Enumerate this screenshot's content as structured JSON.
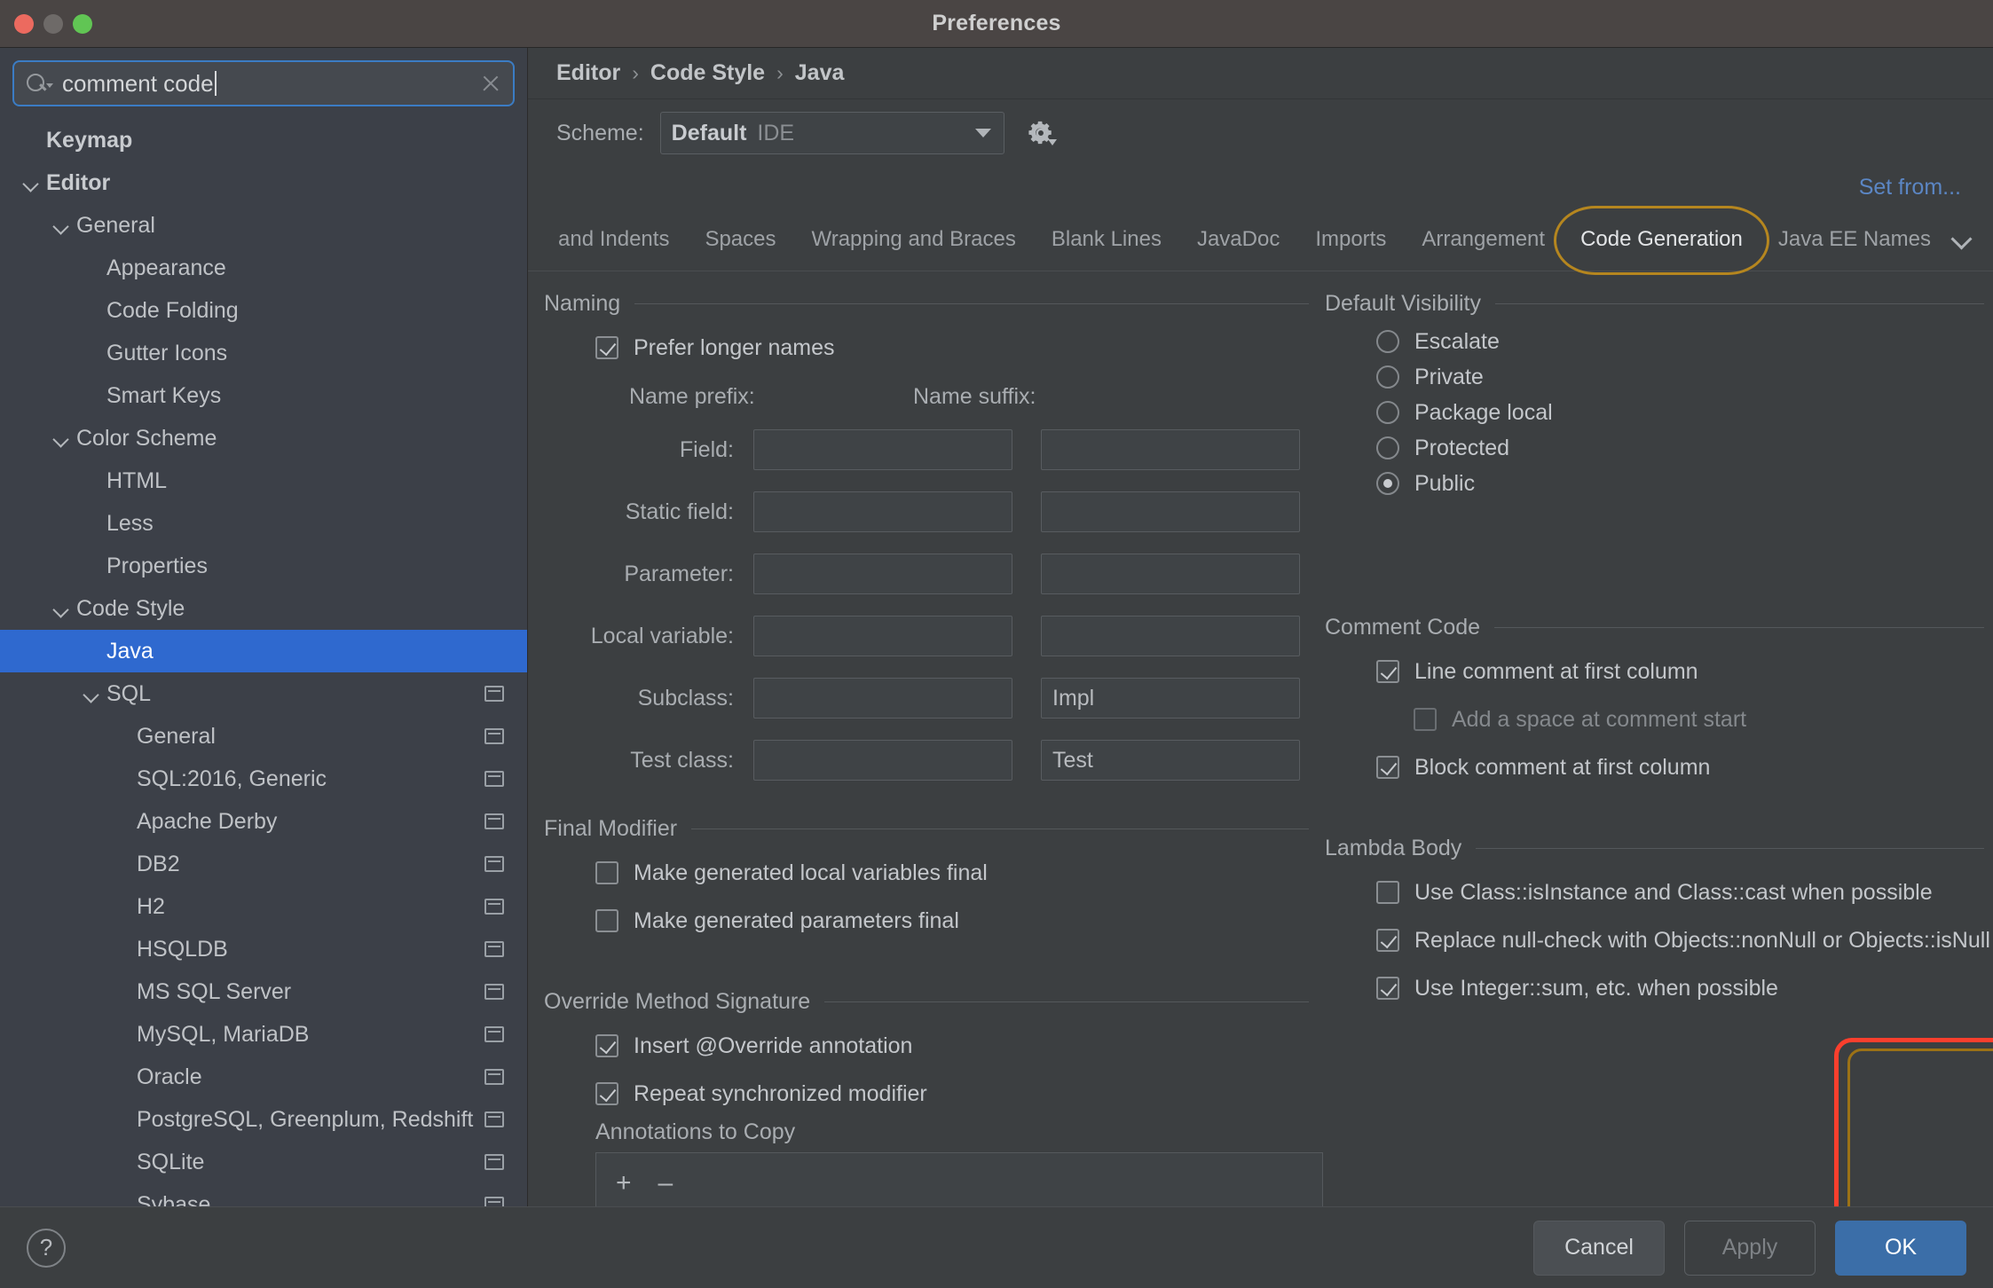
{
  "window": {
    "title": "Preferences"
  },
  "search": {
    "value": "comment code",
    "icon": "search-icon",
    "clear_icon": "clear-icon"
  },
  "sidebar": {
    "items": [
      {
        "label": "Keymap",
        "depth": 0,
        "bold": true,
        "chevron": false,
        "selected": false,
        "badge": false
      },
      {
        "label": "Editor",
        "depth": 0,
        "bold": true,
        "chevron": true,
        "selected": false,
        "badge": false
      },
      {
        "label": "General",
        "depth": 1,
        "bold": false,
        "chevron": true,
        "selected": false,
        "badge": false
      },
      {
        "label": "Appearance",
        "depth": 2,
        "bold": false,
        "chevron": false,
        "selected": false,
        "badge": false
      },
      {
        "label": "Code Folding",
        "depth": 2,
        "bold": false,
        "chevron": false,
        "selected": false,
        "badge": false
      },
      {
        "label": "Gutter Icons",
        "depth": 2,
        "bold": false,
        "chevron": false,
        "selected": false,
        "badge": false
      },
      {
        "label": "Smart Keys",
        "depth": 2,
        "bold": false,
        "chevron": false,
        "selected": false,
        "badge": false
      },
      {
        "label": "Color Scheme",
        "depth": 1,
        "bold": false,
        "chevron": true,
        "selected": false,
        "badge": false
      },
      {
        "label": "HTML",
        "depth": 2,
        "bold": false,
        "chevron": false,
        "selected": false,
        "badge": false
      },
      {
        "label": "Less",
        "depth": 2,
        "bold": false,
        "chevron": false,
        "selected": false,
        "badge": false
      },
      {
        "label": "Properties",
        "depth": 2,
        "bold": false,
        "chevron": false,
        "selected": false,
        "badge": false
      },
      {
        "label": "Code Style",
        "depth": 1,
        "bold": false,
        "chevron": true,
        "selected": false,
        "badge": false
      },
      {
        "label": "Java",
        "depth": 2,
        "bold": false,
        "chevron": false,
        "selected": true,
        "badge": false
      },
      {
        "label": "SQL",
        "depth": 2,
        "bold": false,
        "chevron": true,
        "selected": false,
        "badge": true
      },
      {
        "label": "General",
        "depth": 3,
        "bold": false,
        "chevron": false,
        "selected": false,
        "badge": true
      },
      {
        "label": "SQL:2016, Generic",
        "depth": 3,
        "bold": false,
        "chevron": false,
        "selected": false,
        "badge": true
      },
      {
        "label": "Apache Derby",
        "depth": 3,
        "bold": false,
        "chevron": false,
        "selected": false,
        "badge": true
      },
      {
        "label": "DB2",
        "depth": 3,
        "bold": false,
        "chevron": false,
        "selected": false,
        "badge": true
      },
      {
        "label": "H2",
        "depth": 3,
        "bold": false,
        "chevron": false,
        "selected": false,
        "badge": true
      },
      {
        "label": "HSQLDB",
        "depth": 3,
        "bold": false,
        "chevron": false,
        "selected": false,
        "badge": true
      },
      {
        "label": "MS SQL Server",
        "depth": 3,
        "bold": false,
        "chevron": false,
        "selected": false,
        "badge": true
      },
      {
        "label": "MySQL, MariaDB",
        "depth": 3,
        "bold": false,
        "chevron": false,
        "selected": false,
        "badge": true
      },
      {
        "label": "Oracle",
        "depth": 3,
        "bold": false,
        "chevron": false,
        "selected": false,
        "badge": true
      },
      {
        "label": "PostgreSQL, Greenplum, Redshift",
        "depth": 3,
        "bold": false,
        "chevron": false,
        "selected": false,
        "badge": true
      },
      {
        "label": "SQLite",
        "depth": 3,
        "bold": false,
        "chevron": false,
        "selected": false,
        "badge": true
      },
      {
        "label": "Sybase",
        "depth": 3,
        "bold": false,
        "chevron": false,
        "selected": false,
        "badge": true
      }
    ]
  },
  "breadcrumb": {
    "items": [
      "Editor",
      "Code Style",
      "Java"
    ],
    "separator": "›"
  },
  "scheme": {
    "label": "Scheme:",
    "value": "Default",
    "scope": "IDE",
    "gear_icon": "gear-icon",
    "arrow_icon": "chevron-down-icon"
  },
  "set_from": {
    "label": "Set from..."
  },
  "tabs": {
    "items": [
      "and Indents",
      "Spaces",
      "Wrapping and Braces",
      "Blank Lines",
      "JavaDoc",
      "Imports",
      "Arrangement",
      "Code Generation",
      "Java EE Names"
    ],
    "active": "Code Generation",
    "overflow_icon": "chevron-down-icon"
  },
  "naming": {
    "title": "Naming",
    "prefer_longer_names": {
      "label": "Prefer longer names",
      "checked": true
    },
    "col_prefix": "Name prefix:",
    "col_suffix": "Name suffix:",
    "rows": [
      {
        "label": "Field:",
        "prefix": "",
        "suffix": ""
      },
      {
        "label": "Static field:",
        "prefix": "",
        "suffix": ""
      },
      {
        "label": "Parameter:",
        "prefix": "",
        "suffix": ""
      },
      {
        "label": "Local variable:",
        "prefix": "",
        "suffix": ""
      },
      {
        "label": "Subclass:",
        "prefix": "",
        "suffix": "Impl"
      },
      {
        "label": "Test class:",
        "prefix": "",
        "suffix": "Test"
      }
    ]
  },
  "default_visibility": {
    "title": "Default Visibility",
    "options": [
      {
        "label": "Escalate",
        "selected": false
      },
      {
        "label": "Private",
        "selected": false
      },
      {
        "label": "Package local",
        "selected": false
      },
      {
        "label": "Protected",
        "selected": false
      },
      {
        "label": "Public",
        "selected": true
      }
    ]
  },
  "final_modifier": {
    "title": "Final Modifier",
    "options": [
      {
        "label": "Make generated local variables final",
        "checked": false
      },
      {
        "label": "Make generated parameters final",
        "checked": false
      }
    ]
  },
  "comment_code": {
    "title": "Comment Code",
    "highlight_color": "#fb3f2d",
    "options": [
      {
        "label": "Line comment at first column",
        "checked": true,
        "disabled": false,
        "indent": 0
      },
      {
        "label": "Add a space at comment start",
        "checked": false,
        "disabled": true,
        "indent": 1
      },
      {
        "label": "Block comment at first column",
        "checked": true,
        "disabled": false,
        "indent": 0
      }
    ]
  },
  "override_method_signature": {
    "title": "Override Method Signature",
    "options": [
      {
        "label": "Insert @Override annotation",
        "checked": true
      },
      {
        "label": "Repeat synchronized modifier",
        "checked": true
      }
    ],
    "annotations_label": "Annotations to Copy",
    "add_icon": "plus-icon",
    "remove_icon": "minus-icon"
  },
  "lambda_body": {
    "title": "Lambda Body",
    "options": [
      {
        "label": "Use Class::isInstance and Class::cast when possible",
        "checked": false
      },
      {
        "label": "Replace null-check with Objects::nonNull or Objects::isNull",
        "checked": true
      },
      {
        "label": "Use Integer::sum, etc. when possible",
        "checked": true
      }
    ]
  },
  "footer": {
    "help_label": "?",
    "cancel_label": "Cancel",
    "apply_label": "Apply",
    "ok_label": "OK"
  }
}
